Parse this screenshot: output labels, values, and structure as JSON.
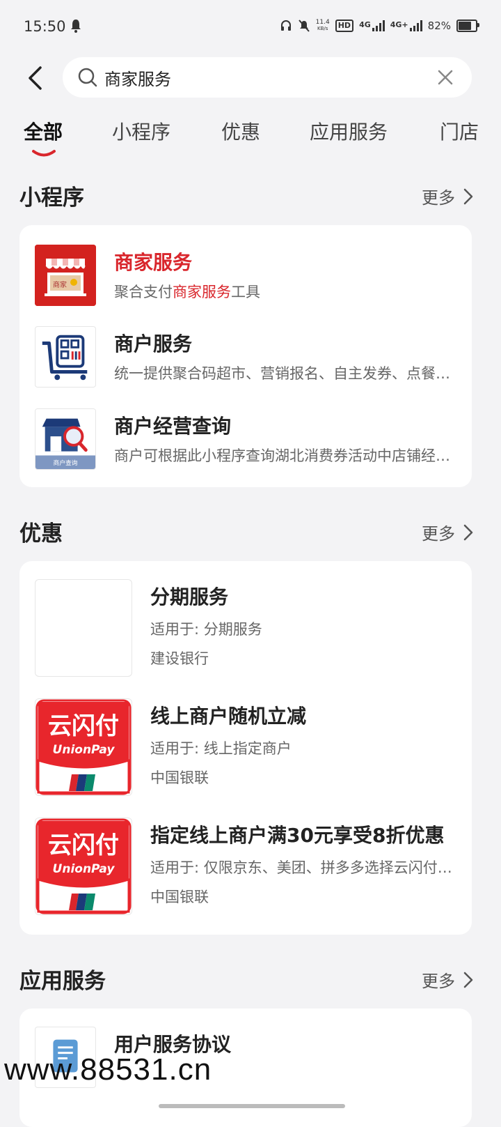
{
  "status_bar": {
    "time": "15:50",
    "speed": "11.4",
    "speed_unit": "KB/s",
    "hd": "HD",
    "net1": "4G",
    "net2": "4G+",
    "battery": "82%",
    "battery_level": 0.82
  },
  "search": {
    "query": "商家服务"
  },
  "tabs": [
    "全部",
    "小程序",
    "优惠",
    "应用服务",
    "门店"
  ],
  "mini_programs": {
    "title": "小程序",
    "more": "更多",
    "items": [
      {
        "title": "商家服务",
        "desc_pre": "聚合支付",
        "desc_hl": "商家服务",
        "desc_post": "工具",
        "icon": "merchant-store-icon",
        "icon_label": "商家"
      },
      {
        "title": "商户服务",
        "desc": "统一提供聚合码超市、营销报名、自主发券、点餐等服务",
        "icon": "merchant-cart-icon"
      },
      {
        "title": "商户经营查询",
        "desc": "商户可根据此小程序查询湖北消费券活动中店铺经营情况",
        "icon": "merchant-query-icon",
        "icon_label": "商户查询"
      }
    ]
  },
  "offers": {
    "title": "优惠",
    "more": "更多",
    "items": [
      {
        "title": "分期服务",
        "sub": "适用于: 分期服务",
        "bank": "建设银行",
        "icon": "blank-icon"
      },
      {
        "title": "线上商户随机立减",
        "sub": "适用于: 线上指定商户",
        "bank": "中国银联",
        "icon": "unionpay-icon",
        "logo_cn": "云闪付",
        "logo_en": "UnionPay"
      },
      {
        "title": "指定线上商户满30元享受8折优惠",
        "sub": "适用于: 仅限京东、美团、拼多多选择云闪付支付",
        "bank": "中国银联",
        "icon": "unionpay-icon",
        "logo_cn": "云闪付",
        "logo_en": "UnionPay"
      }
    ]
  },
  "apps": {
    "title": "应用服务",
    "more": "更多",
    "items": [
      {
        "title": "用户服务协议",
        "icon": "document-icon"
      }
    ]
  },
  "watermark": "www.88531.cn",
  "colors": {
    "accent": "#d9262c",
    "background": "#f3f3f5",
    "card": "#ffffff"
  }
}
